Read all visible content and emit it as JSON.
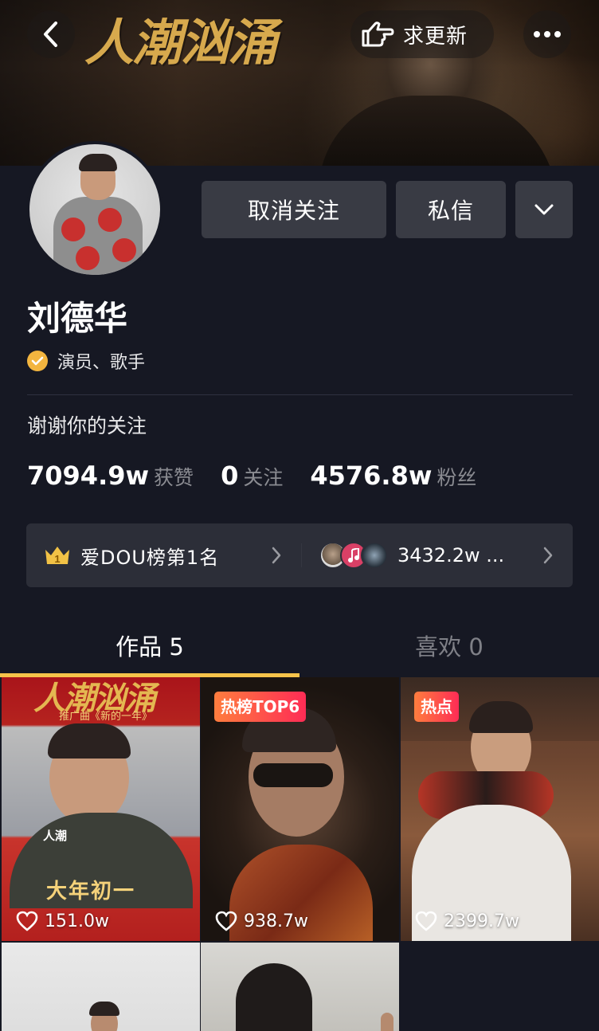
{
  "banner": {
    "title": "人潮汹涌",
    "update_label": "求更新"
  },
  "profile": {
    "name": "刘德华",
    "verification": "演员、歌手",
    "bio": "谢谢你的关注",
    "actions": {
      "unfollow_label": "取消关注",
      "message_label": "私信"
    },
    "stats": [
      {
        "value": "7094.9w",
        "label": "获赞"
      },
      {
        "value": "0",
        "label": "关注"
      },
      {
        "value": "4576.8w",
        "label": "粉丝"
      }
    ]
  },
  "rank_bar": {
    "crown_number": "1",
    "rank_text": "爱DOU榜第1名",
    "fans_text": "3432.2w ..."
  },
  "tabs": [
    {
      "label": "作品 5",
      "active": true
    },
    {
      "label": "喜欢 0",
      "active": false
    }
  ],
  "videos": [
    {
      "likes": "151.0w",
      "tag": "",
      "poster_title": "人潮汹涌",
      "poster_sub": "推广曲《新的一年》",
      "poster_big": "大年初一",
      "poster_badge": "人潮"
    },
    {
      "likes": "938.7w",
      "tag": "热榜TOP6"
    },
    {
      "likes": "2399.7w",
      "tag": "热点"
    },
    {
      "likes": "",
      "tag": ""
    },
    {
      "likes": "",
      "tag": ""
    }
  ],
  "colors": {
    "background": "#161823",
    "accent_underline": "#f6c34a",
    "button_bg": "#393b44",
    "verify_badge": "#f3b53f",
    "tag_gradient_start": "#ff7d3e",
    "tag_gradient_end": "#fe2c55"
  }
}
